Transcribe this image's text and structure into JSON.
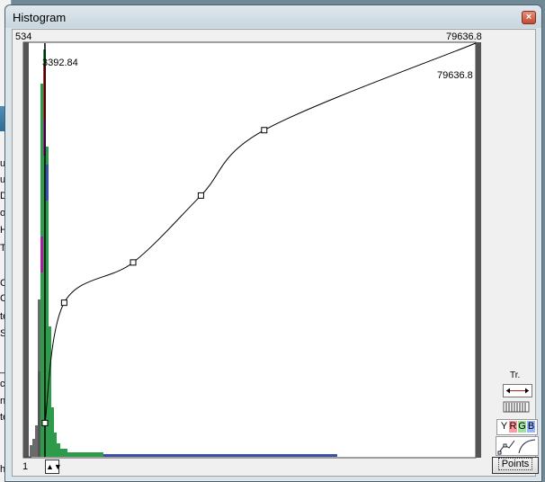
{
  "window": {
    "title": "Histogram",
    "close_glyph": "×"
  },
  "axis": {
    "x_min_label": "534",
    "x_max_label": "79636.8",
    "peak_marker_label": "3392.84",
    "curve_top_label": "79636.8",
    "bottom_value_label": "1"
  },
  "tools": {
    "tr_label": "Tr.",
    "channel_y": "Y",
    "channel_r": "R",
    "channel_g": "G",
    "channel_b": "B",
    "points_label": "Points"
  },
  "background_app": {
    "left_labels": [
      "us",
      "ul",
      "Di",
      "ot",
      "H",
      "To",
      "C",
      "C",
      "te",
      "Sta",
      "_r",
      "c",
      "nt",
      "te",
      "h"
    ]
  },
  "colors": {
    "histogram_gray": "#6a6a6a",
    "histogram_green": "#2e9b4b",
    "histogram_red": "#c0282a",
    "histogram_magenta": "#a4209e",
    "histogram_blue": "#3b4fa8",
    "curve": "#000000",
    "channel_r": "#ff9aa0",
    "channel_g": "#9be39b",
    "channel_b": "#9ab5ff"
  },
  "chart_data": {
    "type": "area",
    "x_range": [
      534,
      79636.8
    ],
    "marker_x": 3392.84,
    "curve_control_points": [
      {
        "x": 3392.84,
        "y": 7000
      },
      {
        "x": 6800,
        "y": 30000
      },
      {
        "x": 19000,
        "y": 37700
      },
      {
        "x": 31000,
        "y": 50500
      },
      {
        "x": 42200,
        "y": 63000
      },
      {
        "x": 79636.8,
        "y": 79636.8
      }
    ]
  }
}
